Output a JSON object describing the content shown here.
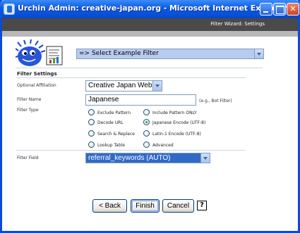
{
  "window": {
    "title": "Urchin Admin: creative-japan.org - Microsoft Internet Explorer"
  },
  "header": {
    "title": "Filter Wizard: Settings"
  },
  "example_filter": {
    "selected": "=> Select Example Filter"
  },
  "filter_settings": {
    "heading": "Filter Settings",
    "affiliation": {
      "label": "Optional Affiliation",
      "selected": "Creative Japan Web"
    },
    "filter_name": {
      "label": "Filter Name",
      "value": "Japanese",
      "hint": "(e.g., Bot Filter)"
    },
    "filter_type": {
      "label": "Filter Type",
      "options": [
        "Exclude Pattern",
        "Include Pattern ONLY",
        "Decode URL",
        "Japanese Encode (UTF-8)",
        "Search & Replace",
        "Latin-1 Encode (UTF-8)",
        "Lookup Table",
        "Advanced"
      ],
      "selected": "Japanese Encode (UTF-8)"
    },
    "filter_field": {
      "label": "Filter Field",
      "selected": "referral_keywords (AUTO)"
    }
  },
  "buttons": {
    "back": "< Back",
    "finish": "Finish",
    "cancel": "Cancel",
    "help": "?"
  },
  "colors": {
    "titlebar": "#0a5ae6",
    "header": "#4a4a4a",
    "selection": "#316ac5"
  }
}
